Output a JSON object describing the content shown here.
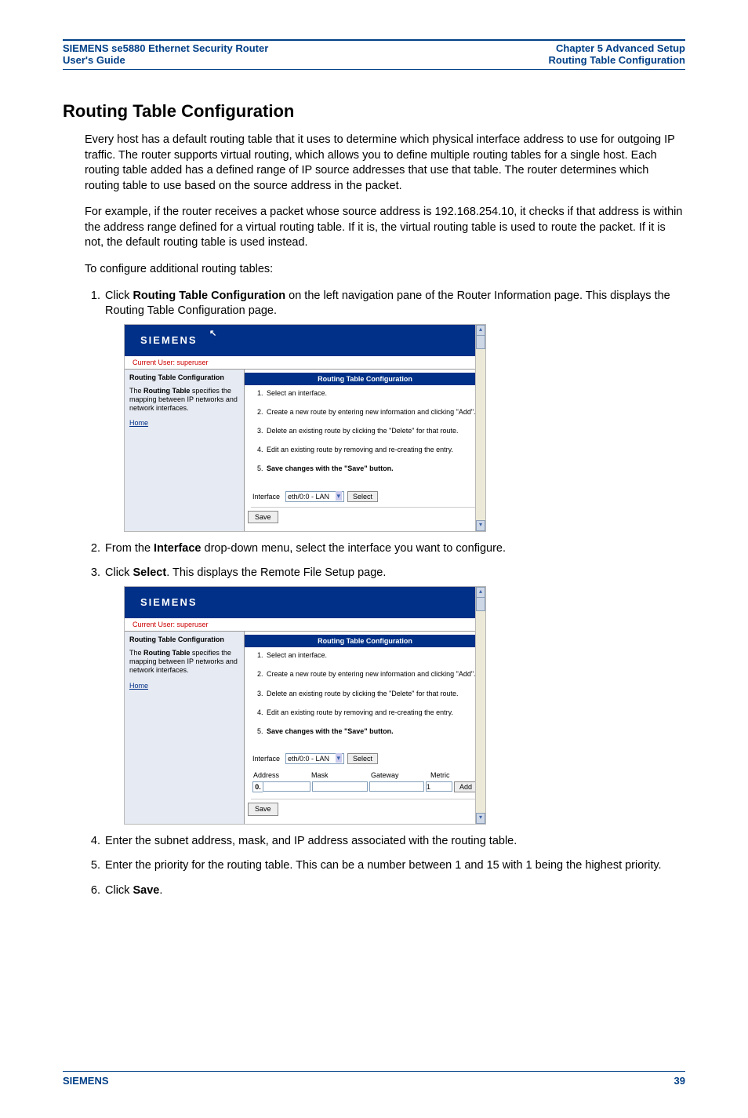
{
  "header": {
    "left1": "SIEMENS se5880 Ethernet Security Router",
    "left2": "User's Guide",
    "right1": "Chapter 5  Advanced Setup",
    "right2": "Routing Table Configuration"
  },
  "title": "Routing Table Configuration",
  "p1": "Every host has a default routing table that it uses to determine which physical interface address to use for outgoing IP traffic. The router supports virtual routing, which allows you to define multiple routing tables for a single host. Each routing table added has a defined range of IP source addresses that use that table. The router determines which routing table to use based on the source address in the packet.",
  "p2": "For example, if the router receives a packet whose source address is 192.168.254.10, it checks if that address is within the address range defined for a virtual routing table. If it is, the virtual routing table is used to route the packet. If it is not, the default routing table is used instead.",
  "p3": "To configure additional routing tables:",
  "steps": {
    "s1a": "Click ",
    "s1b": "Routing Table Configuration",
    "s1c": " on the left navigation pane of the Router Information page. This displays the Routing Table Configuration page.",
    "s2a": "From the ",
    "s2b": "Interface",
    "s2c": " drop-down menu, select the interface you want to configure.",
    "s3a": "Click ",
    "s3b": "Select",
    "s3c": ". This displays the Remote File Setup page.",
    "s4": "Enter the subnet address, mask, and IP address associated with the routing table.",
    "s5": "Enter the priority for the routing table. This can be a number between 1 and 15 with 1 being the highest priority.",
    "s6a": "Click ",
    "s6b": "Save",
    "s6c": "."
  },
  "screenshot": {
    "brand": "SIEMENS",
    "user": "Current User: superuser",
    "sideTitle": "Routing Table Configuration",
    "sideDesc1": "The ",
    "sideDescBold": "Routing Table",
    "sideDesc2": " specifies the mapping between IP networks and network interfaces.",
    "home": "Home",
    "mainTitle": "Routing Table Configuration",
    "instr": [
      "Select an interface.",
      "Create a new route by entering new information and clicking \"Add\".",
      "Delete an existing route by clicking the \"Delete\" for that route.",
      "Edit an existing route by removing and re-creating the entry.",
      "Save changes with the \"Save\" button."
    ],
    "ifaceLabel": "Interface",
    "ifaceValue": "eth/0:0 - LAN",
    "selectBtn": "Select",
    "saveBtn": "Save",
    "cols": {
      "addr": "Address",
      "mask": "Mask",
      "gw": "Gateway",
      "metric": "Metric"
    },
    "row": {
      "zero": "0.",
      "metric": "1",
      "add": "Add"
    }
  },
  "footer": {
    "brand": "SIEMENS",
    "page": "39"
  }
}
